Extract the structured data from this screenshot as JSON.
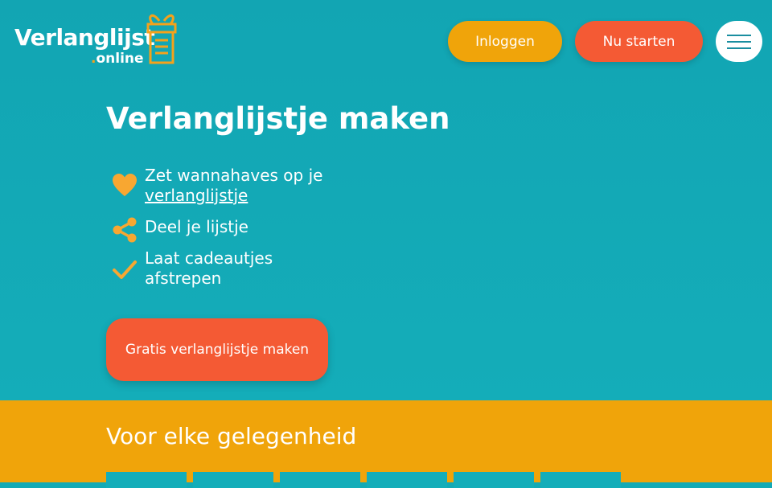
{
  "header": {
    "logo_main": "Verlanglijst",
    "logo_sub_dot": ".",
    "logo_sub": "online",
    "login_label": "Inloggen",
    "start_label": "Nu starten"
  },
  "hero": {
    "title": "Verlanglijstje maken",
    "features": [
      {
        "icon": "heart-icon",
        "text_before": "Zet wannahaves op je ",
        "link": "verlanglijstje"
      },
      {
        "icon": "share-icon",
        "text": "Deel je lijstje"
      },
      {
        "icon": "check-icon",
        "text": "Laat cadeautjes afstrepen"
      }
    ],
    "cta_label": "Gratis verlanglijstje maken"
  },
  "occasion": {
    "title": "Voor elke gelegenheid"
  },
  "colors": {
    "teal": "#13aab6",
    "orange": "#f0a40a",
    "red": "#f45a34",
    "white": "#ffffff"
  }
}
